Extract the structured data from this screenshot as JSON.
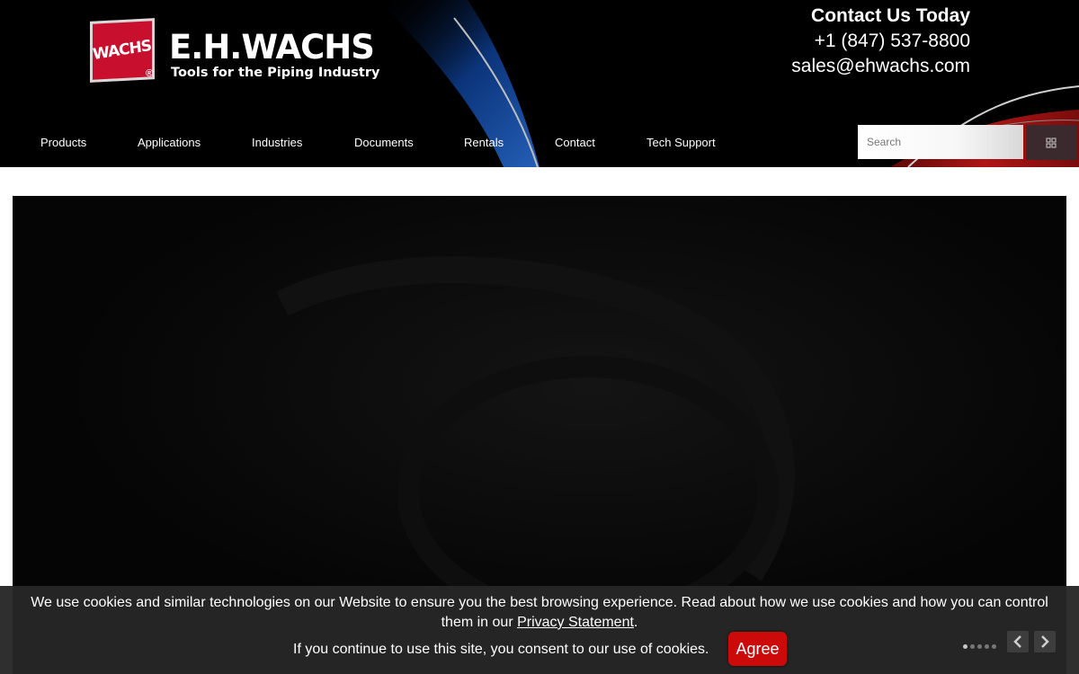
{
  "brand": {
    "badge_text": "WACHS",
    "registered_mark": "®",
    "name": "E.H.WACHS",
    "tagline": "Tools for the Piping Industry"
  },
  "contact": {
    "title": "Contact Us Today",
    "phone": "+1 (847) 537-8800",
    "email": "sales@ehwachs.com"
  },
  "nav": {
    "items": [
      {
        "label": "Products"
      },
      {
        "label": "Applications"
      },
      {
        "label": "Industries"
      },
      {
        "label": "Documents"
      },
      {
        "label": "Rentals"
      },
      {
        "label": "Contact"
      },
      {
        "label": "Tech Support"
      }
    ]
  },
  "search": {
    "placeholder": "Search",
    "button_icon": "search-icon"
  },
  "cookie_banner": {
    "message_before_link": "We use cookies and similar technologies on our Website to ensure you the best browsing experience. Read about how we use cookies and how you can control them in our ",
    "link_text": "Privacy Statement",
    "message_after_link": ".",
    "consent_text": "If you continue to use this site, you consent to our use of cookies.",
    "agree_label": "Agree"
  },
  "slider": {
    "slide_count": 5,
    "active_index": 0,
    "prev_icon": "chevron-left-icon",
    "next_icon": "chevron-right-icon"
  },
  "colors": {
    "brand_red": "#c8102e",
    "agree_red": "#cc0a0a",
    "header_bg": "#000000",
    "accent_blue": "#1a4fa8"
  }
}
